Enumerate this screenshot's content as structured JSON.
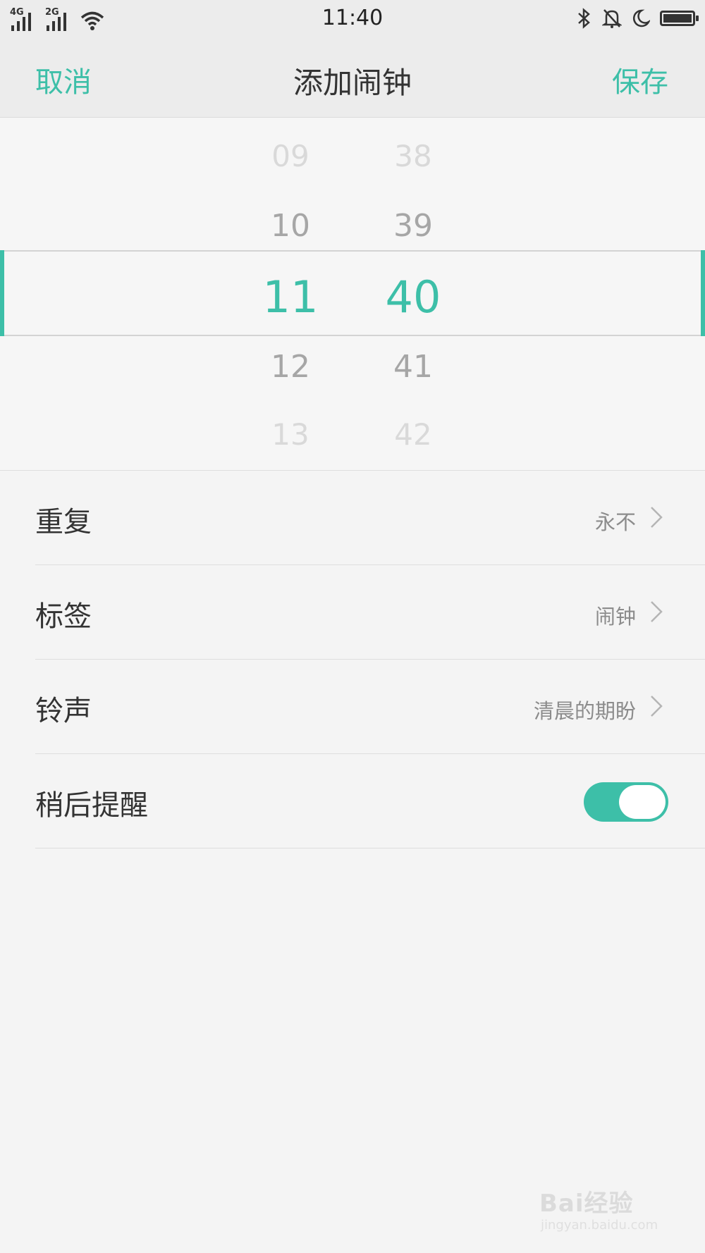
{
  "status_bar": {
    "time": "11:40",
    "signal_1_label": "4G",
    "signal_2_label": "2G",
    "icons": [
      "wifi-icon",
      "bluetooth-icon",
      "bell-off-icon",
      "moon-icon",
      "battery-icon"
    ]
  },
  "header": {
    "cancel_label": "取消",
    "title": "添加闹钟",
    "save_label": "保存"
  },
  "picker": {
    "hours": [
      "09",
      "10",
      "11",
      "12",
      "13"
    ],
    "minutes": [
      "38",
      "39",
      "40",
      "41",
      "42"
    ],
    "selected_hour": "11",
    "selected_minute": "40"
  },
  "settings": {
    "repeat": {
      "label": "重复",
      "value": "永不"
    },
    "tag": {
      "label": "标签",
      "value": "闹钟"
    },
    "ringtone": {
      "label": "铃声",
      "value": "清晨的期盼"
    },
    "snooze": {
      "label": "稍后提醒",
      "enabled": true
    }
  },
  "colors": {
    "accent": "#3dbfa8",
    "background": "#f4f4f4"
  },
  "watermark": {
    "logo": "Bai经验",
    "url": "jingyan.baidu.com"
  }
}
